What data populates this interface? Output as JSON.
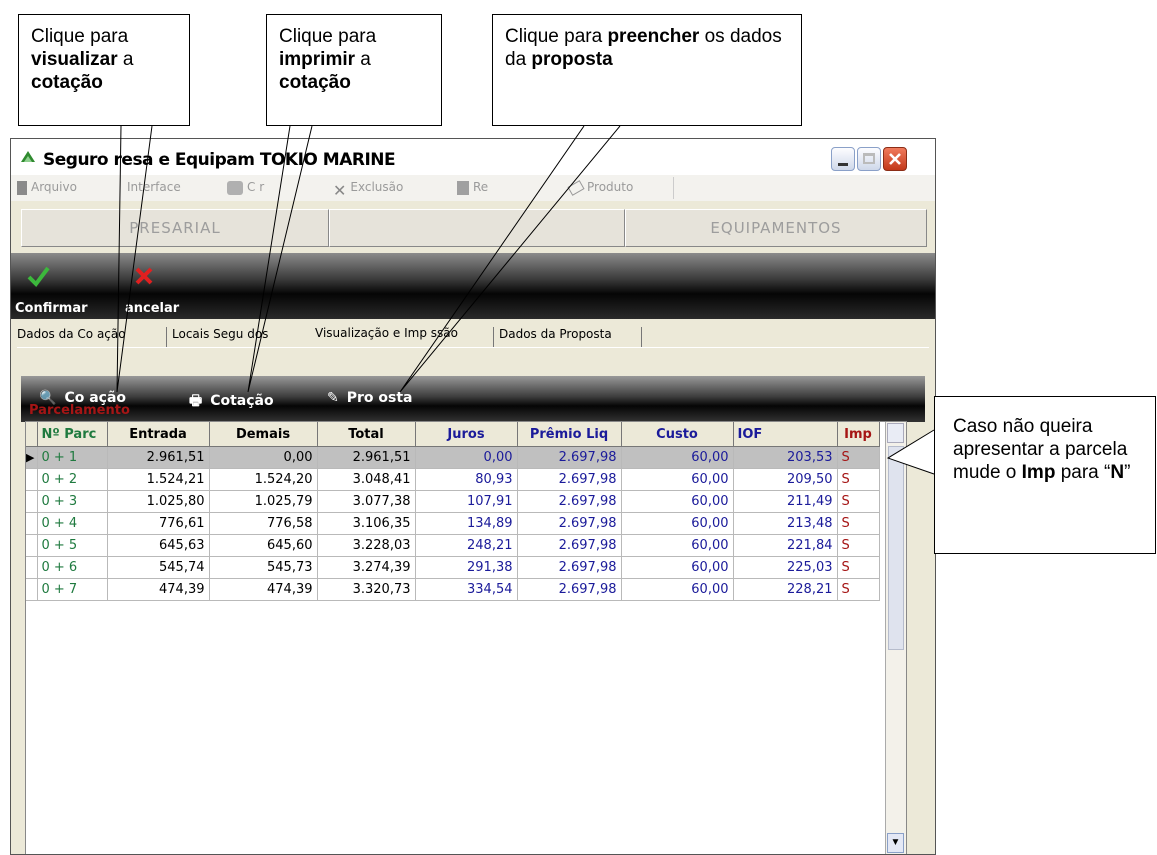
{
  "callouts": [
    {
      "parts": [
        "Clique para ",
        {
          "b": "visualizar"
        },
        " a ",
        {
          "b": "cotação"
        }
      ]
    },
    {
      "parts": [
        "Clique para ",
        {
          "b": "imprimir"
        },
        " a ",
        {
          "b": "cotação"
        }
      ]
    },
    {
      "parts": [
        "Clique para ",
        {
          "b": "preencher"
        },
        " os dados da ",
        {
          "b": "proposta"
        }
      ]
    },
    {
      "parts": [
        "Caso não queira apresentar a parcela mude o ",
        {
          "b": "Imp"
        },
        " para “",
        {
          "b": "N"
        },
        "”"
      ]
    }
  ],
  "window": {
    "title": "Seguro  resa e Equipam   TOKIO MARINE"
  },
  "menu": [
    {
      "label": "Arquivo",
      "icon": "file-icon"
    },
    {
      "label": "Interface",
      "icon": "interface-icon"
    },
    {
      "label": "C      r",
      "icon": "calculate-icon"
    },
    {
      "label": "Exclusão",
      "icon": "x-icon"
    },
    {
      "label": "Re",
      "icon": "report-icon"
    },
    {
      "label": "Produto",
      "icon": "tag-icon"
    }
  ],
  "modules": {
    "left": "  PRESARIAL",
    "right": "EQUIPAMENTOS"
  },
  "actions": {
    "confirm": "Confirmar",
    "cancel": "ancelar"
  },
  "tabs": [
    "Dados da Co  ação",
    "Locais Segu   dos",
    "Visualização e Imp    ssão",
    "Dados da Proposta"
  ],
  "viewbar": [
    "Co  ação",
    "Cotação",
    "Pro  osta"
  ],
  "section_label": "Parcelamento",
  "columns": [
    "Nº Parc",
    "Entrada",
    "Demais",
    "Total",
    "Juros",
    "Prêmio Liq",
    "Custo",
    "IOF",
    "Imp"
  ],
  "rows": [
    [
      "0 + 1",
      "2.961,51",
      "0,00",
      "2.961,51",
      "0,00",
      "2.697,98",
      "60,00",
      "203,53",
      "S"
    ],
    [
      "0 + 2",
      "1.524,21",
      "1.524,20",
      "3.048,41",
      "80,93",
      "2.697,98",
      "60,00",
      "209,50",
      "S"
    ],
    [
      "0 + 3",
      "1.025,80",
      "1.025,79",
      "3.077,38",
      "107,91",
      "2.697,98",
      "60,00",
      "211,49",
      "S"
    ],
    [
      "0 + 4",
      "776,61",
      "776,58",
      "3.106,35",
      "134,89",
      "2.697,98",
      "60,00",
      "213,48",
      "S"
    ],
    [
      "0 + 5",
      "645,63",
      "645,60",
      "3.228,03",
      "248,21",
      "2.697,98",
      "60,00",
      "221,84",
      "S"
    ],
    [
      "0 + 6",
      "545,74",
      "545,73",
      "3.274,39",
      "291,38",
      "2.697,98",
      "60,00",
      "225,03",
      "S"
    ],
    [
      "0 + 7",
      "474,39",
      "474,39",
      "3.320,73",
      "334,54",
      "2.697,98",
      "60,00",
      "228,21",
      "S"
    ]
  ],
  "colors": {
    "green": "#1F7A3F",
    "blue": "#1B1B9A",
    "red": "#A51515",
    "accent": "#2F8A2F"
  }
}
